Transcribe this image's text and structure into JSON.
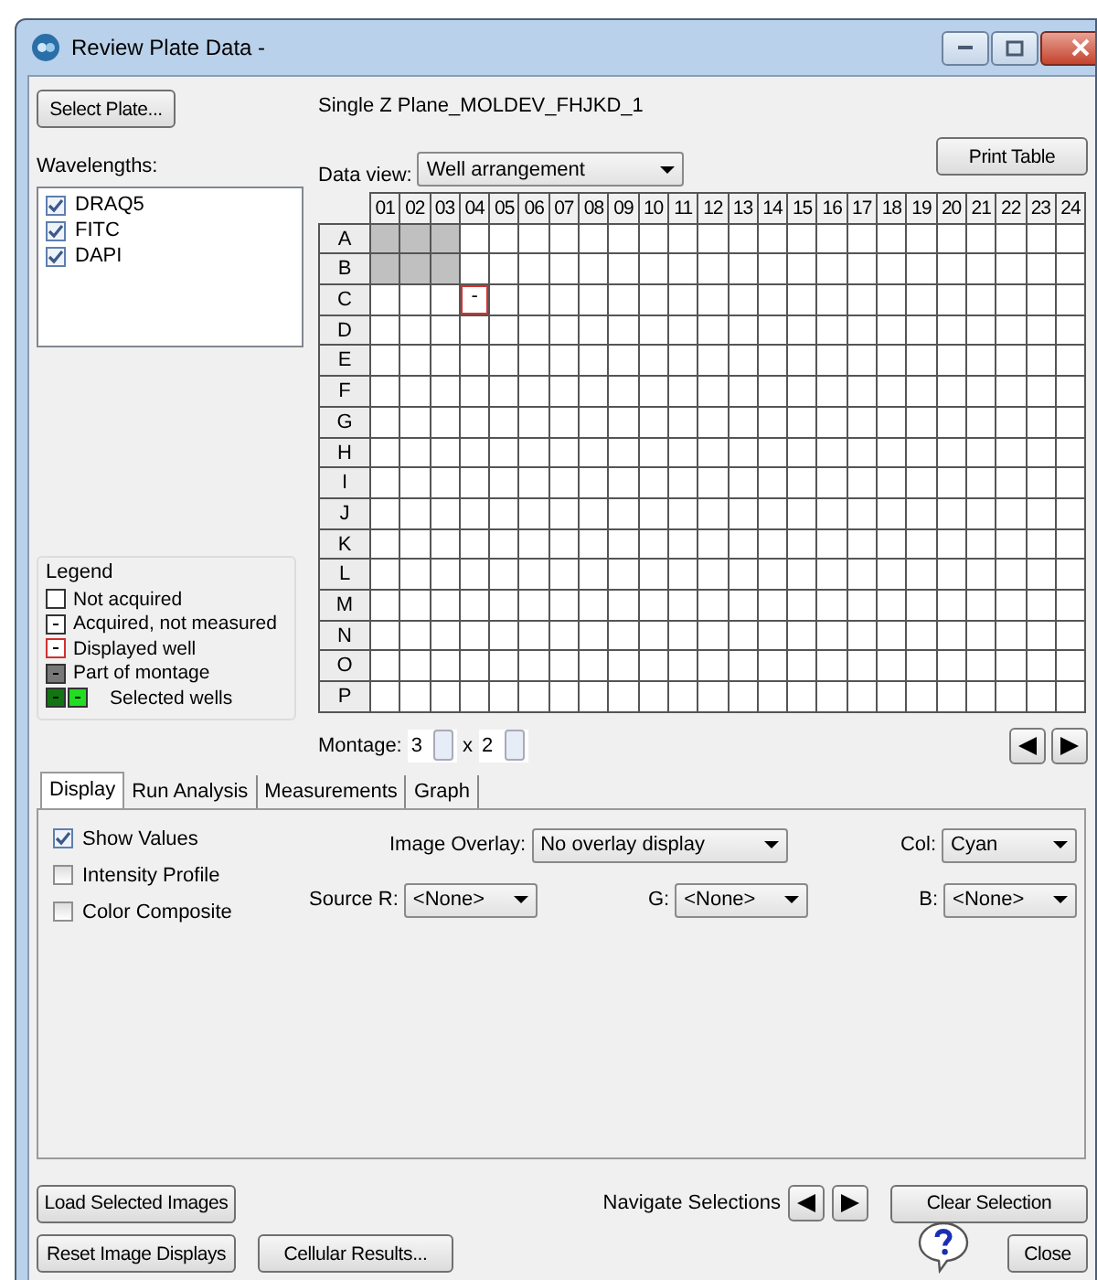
{
  "window": {
    "title": "Review Plate Data -"
  },
  "select_plate_button": "Select Plate...",
  "plate_name": "Single Z Plane_MOLDEV_FHJKD_1",
  "wavelengths": {
    "label": "Wavelengths:",
    "items": [
      {
        "label": "DRAQ5",
        "checked": true
      },
      {
        "label": "FITC",
        "checked": true
      },
      {
        "label": "DAPI",
        "checked": true
      }
    ]
  },
  "data_view": {
    "label": "Data view:",
    "value": "Well arrangement"
  },
  "print_button": "Print Table",
  "plate": {
    "columns": [
      "01",
      "02",
      "03",
      "04",
      "05",
      "06",
      "07",
      "08",
      "09",
      "10",
      "11",
      "12",
      "13",
      "14",
      "15",
      "16",
      "17",
      "18",
      "19",
      "20",
      "21",
      "22",
      "23",
      "24"
    ],
    "rows": [
      {
        "label": "A",
        "wells": [
          {
            "kind": "montage"
          },
          {
            "kind": "montage"
          },
          {
            "kind": "montage"
          },
          {
            "kind": "empty"
          },
          {
            "kind": "empty"
          },
          {
            "kind": "empty"
          },
          {
            "kind": "empty"
          },
          {
            "kind": "empty"
          },
          {
            "kind": "empty"
          },
          {
            "kind": "empty"
          },
          {
            "kind": "empty"
          },
          {
            "kind": "empty"
          },
          {
            "kind": "empty"
          },
          {
            "kind": "empty"
          },
          {
            "kind": "empty"
          },
          {
            "kind": "empty"
          },
          {
            "kind": "empty"
          },
          {
            "kind": "empty"
          },
          {
            "kind": "empty"
          },
          {
            "kind": "empty"
          },
          {
            "kind": "empty"
          },
          {
            "kind": "empty"
          },
          {
            "kind": "empty"
          },
          {
            "kind": "empty"
          }
        ]
      },
      {
        "label": "B",
        "wells": [
          {
            "kind": "montage"
          },
          {
            "kind": "montage"
          },
          {
            "kind": "montage"
          },
          {
            "kind": "empty"
          },
          {
            "kind": "empty"
          },
          {
            "kind": "empty"
          },
          {
            "kind": "empty"
          },
          {
            "kind": "empty"
          },
          {
            "kind": "empty"
          },
          {
            "kind": "empty"
          },
          {
            "kind": "empty"
          },
          {
            "kind": "empty"
          },
          {
            "kind": "empty"
          },
          {
            "kind": "empty"
          },
          {
            "kind": "empty"
          },
          {
            "kind": "empty"
          },
          {
            "kind": "empty"
          },
          {
            "kind": "empty"
          },
          {
            "kind": "empty"
          },
          {
            "kind": "empty"
          },
          {
            "kind": "empty"
          },
          {
            "kind": "empty"
          },
          {
            "kind": "empty"
          },
          {
            "kind": "empty"
          }
        ]
      },
      {
        "label": "C",
        "wells": [
          {
            "kind": "empty"
          },
          {
            "kind": "empty"
          },
          {
            "kind": "empty"
          },
          {
            "kind": "displayed",
            "value": "-"
          },
          {
            "kind": "empty"
          },
          {
            "kind": "empty"
          },
          {
            "kind": "empty"
          },
          {
            "kind": "empty"
          },
          {
            "kind": "empty"
          },
          {
            "kind": "empty"
          },
          {
            "kind": "empty"
          },
          {
            "kind": "empty"
          },
          {
            "kind": "empty"
          },
          {
            "kind": "empty"
          },
          {
            "kind": "empty"
          },
          {
            "kind": "empty"
          },
          {
            "kind": "empty"
          },
          {
            "kind": "empty"
          },
          {
            "kind": "empty"
          },
          {
            "kind": "empty"
          },
          {
            "kind": "empty"
          },
          {
            "kind": "empty"
          },
          {
            "kind": "empty"
          },
          {
            "kind": "empty"
          }
        ]
      },
      {
        "label": "D",
        "wells": [
          {
            "kind": "empty"
          },
          {
            "kind": "empty"
          },
          {
            "kind": "empty"
          },
          {
            "kind": "empty"
          },
          {
            "kind": "empty"
          },
          {
            "kind": "empty"
          },
          {
            "kind": "empty"
          },
          {
            "kind": "empty"
          },
          {
            "kind": "empty"
          },
          {
            "kind": "empty"
          },
          {
            "kind": "empty"
          },
          {
            "kind": "empty"
          },
          {
            "kind": "empty"
          },
          {
            "kind": "empty"
          },
          {
            "kind": "empty"
          },
          {
            "kind": "empty"
          },
          {
            "kind": "empty"
          },
          {
            "kind": "empty"
          },
          {
            "kind": "empty"
          },
          {
            "kind": "empty"
          },
          {
            "kind": "empty"
          },
          {
            "kind": "empty"
          },
          {
            "kind": "empty"
          },
          {
            "kind": "empty"
          }
        ]
      },
      {
        "label": "E",
        "wells": [
          {
            "kind": "empty"
          },
          {
            "kind": "empty"
          },
          {
            "kind": "empty"
          },
          {
            "kind": "empty"
          },
          {
            "kind": "empty"
          },
          {
            "kind": "empty"
          },
          {
            "kind": "empty"
          },
          {
            "kind": "empty"
          },
          {
            "kind": "empty"
          },
          {
            "kind": "empty"
          },
          {
            "kind": "empty"
          },
          {
            "kind": "empty"
          },
          {
            "kind": "empty"
          },
          {
            "kind": "empty"
          },
          {
            "kind": "empty"
          },
          {
            "kind": "empty"
          },
          {
            "kind": "empty"
          },
          {
            "kind": "empty"
          },
          {
            "kind": "empty"
          },
          {
            "kind": "empty"
          },
          {
            "kind": "empty"
          },
          {
            "kind": "empty"
          },
          {
            "kind": "empty"
          },
          {
            "kind": "empty"
          }
        ]
      },
      {
        "label": "F",
        "wells": [
          {
            "kind": "empty"
          },
          {
            "kind": "empty"
          },
          {
            "kind": "empty"
          },
          {
            "kind": "empty"
          },
          {
            "kind": "empty"
          },
          {
            "kind": "empty"
          },
          {
            "kind": "empty"
          },
          {
            "kind": "empty"
          },
          {
            "kind": "empty"
          },
          {
            "kind": "empty"
          },
          {
            "kind": "empty"
          },
          {
            "kind": "empty"
          },
          {
            "kind": "empty"
          },
          {
            "kind": "empty"
          },
          {
            "kind": "empty"
          },
          {
            "kind": "empty"
          },
          {
            "kind": "empty"
          },
          {
            "kind": "empty"
          },
          {
            "kind": "empty"
          },
          {
            "kind": "empty"
          },
          {
            "kind": "empty"
          },
          {
            "kind": "empty"
          },
          {
            "kind": "empty"
          },
          {
            "kind": "empty"
          }
        ]
      },
      {
        "label": "G",
        "wells": [
          {
            "kind": "empty"
          },
          {
            "kind": "empty"
          },
          {
            "kind": "empty"
          },
          {
            "kind": "empty"
          },
          {
            "kind": "empty"
          },
          {
            "kind": "empty"
          },
          {
            "kind": "empty"
          },
          {
            "kind": "empty"
          },
          {
            "kind": "empty"
          },
          {
            "kind": "empty"
          },
          {
            "kind": "empty"
          },
          {
            "kind": "empty"
          },
          {
            "kind": "empty"
          },
          {
            "kind": "empty"
          },
          {
            "kind": "empty"
          },
          {
            "kind": "empty"
          },
          {
            "kind": "empty"
          },
          {
            "kind": "empty"
          },
          {
            "kind": "empty"
          },
          {
            "kind": "empty"
          },
          {
            "kind": "empty"
          },
          {
            "kind": "empty"
          },
          {
            "kind": "empty"
          },
          {
            "kind": "empty"
          }
        ]
      },
      {
        "label": "H",
        "wells": [
          {
            "kind": "empty"
          },
          {
            "kind": "empty"
          },
          {
            "kind": "empty"
          },
          {
            "kind": "empty"
          },
          {
            "kind": "empty"
          },
          {
            "kind": "empty"
          },
          {
            "kind": "empty"
          },
          {
            "kind": "empty"
          },
          {
            "kind": "empty"
          },
          {
            "kind": "empty"
          },
          {
            "kind": "empty"
          },
          {
            "kind": "empty"
          },
          {
            "kind": "empty"
          },
          {
            "kind": "empty"
          },
          {
            "kind": "empty"
          },
          {
            "kind": "empty"
          },
          {
            "kind": "empty"
          },
          {
            "kind": "empty"
          },
          {
            "kind": "empty"
          },
          {
            "kind": "empty"
          },
          {
            "kind": "empty"
          },
          {
            "kind": "empty"
          },
          {
            "kind": "empty"
          },
          {
            "kind": "empty"
          }
        ]
      },
      {
        "label": "I",
        "wells": [
          {
            "kind": "empty"
          },
          {
            "kind": "empty"
          },
          {
            "kind": "empty"
          },
          {
            "kind": "empty"
          },
          {
            "kind": "empty"
          },
          {
            "kind": "empty"
          },
          {
            "kind": "empty"
          },
          {
            "kind": "empty"
          },
          {
            "kind": "empty"
          },
          {
            "kind": "empty"
          },
          {
            "kind": "empty"
          },
          {
            "kind": "empty"
          },
          {
            "kind": "empty"
          },
          {
            "kind": "empty"
          },
          {
            "kind": "empty"
          },
          {
            "kind": "empty"
          },
          {
            "kind": "empty"
          },
          {
            "kind": "empty"
          },
          {
            "kind": "empty"
          },
          {
            "kind": "empty"
          },
          {
            "kind": "empty"
          },
          {
            "kind": "empty"
          },
          {
            "kind": "empty"
          },
          {
            "kind": "empty"
          }
        ]
      },
      {
        "label": "J",
        "wells": [
          {
            "kind": "empty"
          },
          {
            "kind": "empty"
          },
          {
            "kind": "empty"
          },
          {
            "kind": "empty"
          },
          {
            "kind": "empty"
          },
          {
            "kind": "empty"
          },
          {
            "kind": "empty"
          },
          {
            "kind": "empty"
          },
          {
            "kind": "empty"
          },
          {
            "kind": "empty"
          },
          {
            "kind": "empty"
          },
          {
            "kind": "empty"
          },
          {
            "kind": "empty"
          },
          {
            "kind": "empty"
          },
          {
            "kind": "empty"
          },
          {
            "kind": "empty"
          },
          {
            "kind": "empty"
          },
          {
            "kind": "empty"
          },
          {
            "kind": "empty"
          },
          {
            "kind": "empty"
          },
          {
            "kind": "empty"
          },
          {
            "kind": "empty"
          },
          {
            "kind": "empty"
          },
          {
            "kind": "empty"
          }
        ]
      },
      {
        "label": "K",
        "wells": [
          {
            "kind": "empty"
          },
          {
            "kind": "empty"
          },
          {
            "kind": "empty"
          },
          {
            "kind": "empty"
          },
          {
            "kind": "empty"
          },
          {
            "kind": "empty"
          },
          {
            "kind": "empty"
          },
          {
            "kind": "empty"
          },
          {
            "kind": "empty"
          },
          {
            "kind": "empty"
          },
          {
            "kind": "empty"
          },
          {
            "kind": "empty"
          },
          {
            "kind": "empty"
          },
          {
            "kind": "empty"
          },
          {
            "kind": "empty"
          },
          {
            "kind": "empty"
          },
          {
            "kind": "empty"
          },
          {
            "kind": "empty"
          },
          {
            "kind": "empty"
          },
          {
            "kind": "empty"
          },
          {
            "kind": "empty"
          },
          {
            "kind": "empty"
          },
          {
            "kind": "empty"
          },
          {
            "kind": "empty"
          }
        ]
      },
      {
        "label": "L",
        "wells": [
          {
            "kind": "empty"
          },
          {
            "kind": "empty"
          },
          {
            "kind": "empty"
          },
          {
            "kind": "empty"
          },
          {
            "kind": "empty"
          },
          {
            "kind": "empty"
          },
          {
            "kind": "empty"
          },
          {
            "kind": "empty"
          },
          {
            "kind": "empty"
          },
          {
            "kind": "empty"
          },
          {
            "kind": "empty"
          },
          {
            "kind": "empty"
          },
          {
            "kind": "empty"
          },
          {
            "kind": "empty"
          },
          {
            "kind": "empty"
          },
          {
            "kind": "empty"
          },
          {
            "kind": "empty"
          },
          {
            "kind": "empty"
          },
          {
            "kind": "empty"
          },
          {
            "kind": "empty"
          },
          {
            "kind": "empty"
          },
          {
            "kind": "empty"
          },
          {
            "kind": "empty"
          },
          {
            "kind": "empty"
          }
        ]
      },
      {
        "label": "M",
        "wells": [
          {
            "kind": "empty"
          },
          {
            "kind": "empty"
          },
          {
            "kind": "empty"
          },
          {
            "kind": "empty"
          },
          {
            "kind": "empty"
          },
          {
            "kind": "empty"
          },
          {
            "kind": "empty"
          },
          {
            "kind": "empty"
          },
          {
            "kind": "empty"
          },
          {
            "kind": "empty"
          },
          {
            "kind": "empty"
          },
          {
            "kind": "empty"
          },
          {
            "kind": "empty"
          },
          {
            "kind": "empty"
          },
          {
            "kind": "empty"
          },
          {
            "kind": "empty"
          },
          {
            "kind": "empty"
          },
          {
            "kind": "empty"
          },
          {
            "kind": "empty"
          },
          {
            "kind": "empty"
          },
          {
            "kind": "empty"
          },
          {
            "kind": "empty"
          },
          {
            "kind": "empty"
          },
          {
            "kind": "empty"
          }
        ]
      },
      {
        "label": "N",
        "wells": [
          {
            "kind": "empty"
          },
          {
            "kind": "empty"
          },
          {
            "kind": "empty"
          },
          {
            "kind": "empty"
          },
          {
            "kind": "empty"
          },
          {
            "kind": "empty"
          },
          {
            "kind": "empty"
          },
          {
            "kind": "empty"
          },
          {
            "kind": "empty"
          },
          {
            "kind": "empty"
          },
          {
            "kind": "empty"
          },
          {
            "kind": "empty"
          },
          {
            "kind": "empty"
          },
          {
            "kind": "empty"
          },
          {
            "kind": "empty"
          },
          {
            "kind": "empty"
          },
          {
            "kind": "empty"
          },
          {
            "kind": "empty"
          },
          {
            "kind": "empty"
          },
          {
            "kind": "empty"
          },
          {
            "kind": "empty"
          },
          {
            "kind": "empty"
          },
          {
            "kind": "empty"
          },
          {
            "kind": "empty"
          }
        ]
      },
      {
        "label": "O",
        "wells": [
          {
            "kind": "empty"
          },
          {
            "kind": "empty"
          },
          {
            "kind": "empty"
          },
          {
            "kind": "empty"
          },
          {
            "kind": "empty"
          },
          {
            "kind": "empty"
          },
          {
            "kind": "empty"
          },
          {
            "kind": "empty"
          },
          {
            "kind": "empty"
          },
          {
            "kind": "empty"
          },
          {
            "kind": "empty"
          },
          {
            "kind": "empty"
          },
          {
            "kind": "empty"
          },
          {
            "kind": "empty"
          },
          {
            "kind": "empty"
          },
          {
            "kind": "empty"
          },
          {
            "kind": "empty"
          },
          {
            "kind": "empty"
          },
          {
            "kind": "empty"
          },
          {
            "kind": "empty"
          },
          {
            "kind": "empty"
          },
          {
            "kind": "empty"
          },
          {
            "kind": "empty"
          },
          {
            "kind": "empty"
          }
        ]
      },
      {
        "label": "P",
        "wells": [
          {
            "kind": "empty"
          },
          {
            "kind": "empty"
          },
          {
            "kind": "empty"
          },
          {
            "kind": "empty"
          },
          {
            "kind": "empty"
          },
          {
            "kind": "empty"
          },
          {
            "kind": "empty"
          },
          {
            "kind": "empty"
          },
          {
            "kind": "empty"
          },
          {
            "kind": "empty"
          },
          {
            "kind": "empty"
          },
          {
            "kind": "empty"
          },
          {
            "kind": "empty"
          },
          {
            "kind": "empty"
          },
          {
            "kind": "empty"
          },
          {
            "kind": "empty"
          },
          {
            "kind": "empty"
          },
          {
            "kind": "empty"
          },
          {
            "kind": "empty"
          },
          {
            "kind": "empty"
          },
          {
            "kind": "empty"
          },
          {
            "kind": "empty"
          },
          {
            "kind": "empty"
          },
          {
            "kind": "empty"
          }
        ]
      }
    ]
  },
  "legend": {
    "title": "Legend",
    "items": [
      {
        "kind": "not_acquired",
        "label": "Not acquired"
      },
      {
        "kind": "acquired",
        "label": "Acquired, not measured"
      },
      {
        "kind": "displayed",
        "label": "Displayed well"
      },
      {
        "kind": "montage",
        "label": "Part of montage"
      },
      {
        "kind": "selected",
        "label": "Selected wells"
      }
    ]
  },
  "montage": {
    "label": "Montage:",
    "columns": "3",
    "separator": "x",
    "rows": "2"
  },
  "tabs": [
    {
      "label": "Display",
      "selected": true
    },
    {
      "label": "Run Analysis",
      "selected": false
    },
    {
      "label": "Measurements",
      "selected": false
    },
    {
      "label": "Graph",
      "selected": false
    }
  ],
  "display": {
    "checkboxes": [
      {
        "label": "Show Values",
        "checked": true
      },
      {
        "label": "Intensity Profile",
        "checked": false
      },
      {
        "label": "Color Composite",
        "checked": false
      }
    ],
    "image_overlay": {
      "label": "Image Overlay:",
      "value": "No overlay display"
    },
    "col": {
      "label": "Col:",
      "value": "Cyan"
    },
    "source_r": {
      "label": "Source R:",
      "value": "<None>"
    },
    "source_g": {
      "label": "G:",
      "value": "<None>"
    },
    "source_b": {
      "label": "B:",
      "value": "<None>"
    }
  },
  "buttons": {
    "load": "Load Selected Images",
    "navigate_label": "Navigate Selections",
    "clear": "Clear Selection",
    "reset": "Reset Image Displays",
    "cellular": "Cellular Results...",
    "close": "Close"
  }
}
